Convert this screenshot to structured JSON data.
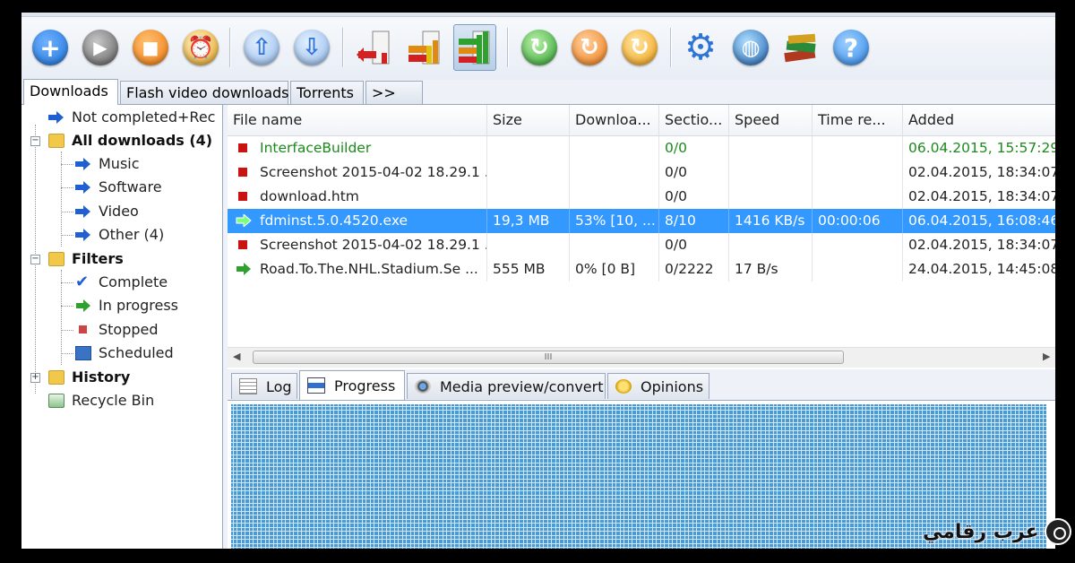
{
  "toolbar": {
    "buttons": [
      {
        "icon": "add-download-icon",
        "glyph": "+",
        "color": "#1e73d9"
      },
      {
        "icon": "play-icon",
        "glyph": "▶",
        "color": "#5c5c5c"
      },
      {
        "icon": "stop-icon",
        "glyph": "■",
        "color": "#f07b10"
      },
      {
        "icon": "scheduler-clock-icon",
        "glyph": "⏰",
        "color": "#e0a020"
      },
      {
        "icon": "move-up-icon",
        "glyph": "⇧",
        "color": "#2e74d6"
      },
      {
        "icon": "move-down-icon",
        "glyph": "⇩",
        "color": "#2e74d6"
      },
      {
        "icon": "traffic-low-icon",
        "glyph": "",
        "color": "#d32020"
      },
      {
        "icon": "traffic-medium-icon",
        "glyph": "",
        "color": "#e08a10"
      },
      {
        "icon": "traffic-high-icon",
        "glyph": "",
        "color": "#2fa12f"
      },
      {
        "icon": "start-all-icon",
        "glyph": "↻",
        "color": "#2fa12f"
      },
      {
        "icon": "stop-all-icon",
        "glyph": "↻",
        "color": "#f07b10"
      },
      {
        "icon": "pause-all-icon",
        "glyph": "↻",
        "color": "#f0a010"
      },
      {
        "icon": "settings-gear-icon",
        "glyph": "⚙",
        "color": "#2e74d6"
      },
      {
        "icon": "site-manager-globe-icon",
        "glyph": "◍",
        "color": "#2e74d6"
      },
      {
        "icon": "books-icon",
        "glyph": "▤",
        "color": "#b03a20"
      },
      {
        "icon": "help-icon",
        "glyph": "?",
        "color": "#2e86e8"
      }
    ]
  },
  "tabs": [
    {
      "label": "Downloads",
      "active": true
    },
    {
      "label": "Flash video downloads",
      "active": false
    },
    {
      "label": "Torrents",
      "active": false
    },
    {
      "label": ">>",
      "active": false
    }
  ],
  "tree": {
    "not_completed": "Not completed+Rec",
    "all_downloads": "All downloads (4)",
    "music": "Music",
    "software": "Software",
    "video": "Video",
    "other": "Other (4)",
    "filters": "Filters",
    "complete": "Complete",
    "in_progress": "In progress",
    "stopped": "Stopped",
    "scheduled": "Scheduled",
    "history": "History",
    "recycle_bin": "Recycle Bin"
  },
  "list": {
    "columns": [
      "File name",
      "Size",
      "Downloa...",
      "Sectio...",
      "Speed",
      "Time re...",
      "Added"
    ],
    "rows": [
      {
        "status": "stopped",
        "name": "InterfaceBuilder",
        "size": "",
        "downloaded": "",
        "sections": "0/0",
        "speed": "",
        "time": "",
        "added": "06.04.2015, 15:57:29",
        "green": true,
        "selected": false
      },
      {
        "status": "stopped",
        "name": "Screenshot 2015-04-02 18.29.1 ...",
        "size": "",
        "downloaded": "",
        "sections": "0/0",
        "speed": "",
        "time": "",
        "added": "02.04.2015, 18:34:07",
        "green": false,
        "selected": false
      },
      {
        "status": "stopped",
        "name": "download.htm",
        "size": "",
        "downloaded": "",
        "sections": "0/0",
        "speed": "",
        "time": "",
        "added": "02.04.2015, 18:34:07",
        "green": false,
        "selected": false
      },
      {
        "status": "downloading",
        "name": "fdminst.5.0.4520.exe",
        "size": "19,3 MB",
        "downloaded": "53% [10, ...",
        "sections": "8/10",
        "speed": "1416 KB/s",
        "time": "00:00:06",
        "added": "06.04.2015, 16:08:46",
        "green": false,
        "selected": true
      },
      {
        "status": "stopped",
        "name": "Screenshot 2015-04-02 18.29.1 ...",
        "size": "",
        "downloaded": "",
        "sections": "0/0",
        "speed": "",
        "time": "",
        "added": "02.04.2015, 18:34:07",
        "green": false,
        "selected": false
      },
      {
        "status": "downloading",
        "name": "Road.To.The.NHL.Stadium.Se ...",
        "size": "555 MB",
        "downloaded": "0% [0 B]",
        "sections": "0/2222",
        "speed": "17 B/s",
        "time": "",
        "added": "24.04.2015, 14:45:08",
        "green": false,
        "selected": false
      }
    ],
    "scroll_grip": "III"
  },
  "bottom_tabs": [
    {
      "label": "Log",
      "icon": "log-icon",
      "active": false
    },
    {
      "label": "Progress",
      "icon": "progress-icon",
      "active": true
    },
    {
      "label": "Media preview/convert",
      "icon": "media-camera-icon",
      "active": false
    },
    {
      "label": "Opinions",
      "icon": "opinions-chat-icon",
      "active": false
    }
  ],
  "watermark": {
    "text": "عرب رقامي"
  },
  "colors": {
    "selection": "#3399ff",
    "progress_fill": "#4a9ad4",
    "green_text": "#1b8a1b",
    "stopped_red": "#cc1111",
    "arrow_green": "#2fa12f"
  }
}
